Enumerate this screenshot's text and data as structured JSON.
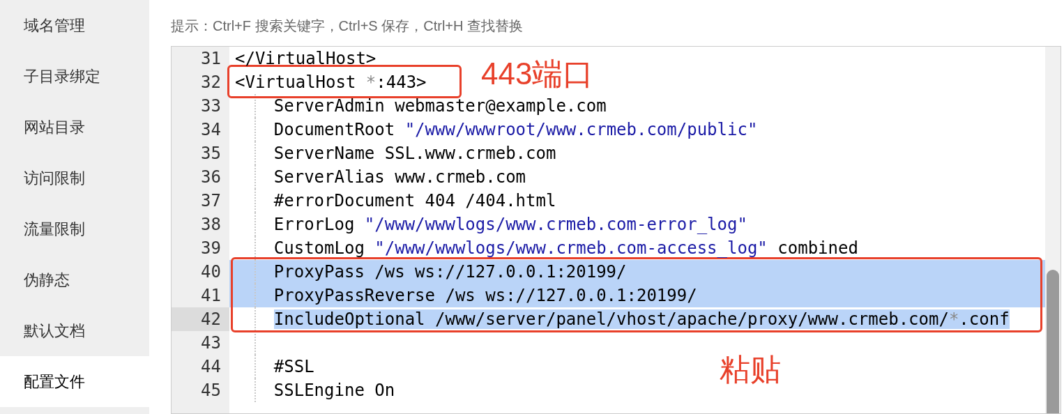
{
  "sidebar": {
    "items": [
      {
        "label": "域名管理",
        "selected": false
      },
      {
        "label": "子目录绑定",
        "selected": false
      },
      {
        "label": "网站目录",
        "selected": false
      },
      {
        "label": "访问限制",
        "selected": false
      },
      {
        "label": "流量限制",
        "selected": false
      },
      {
        "label": "伪静态",
        "selected": false
      },
      {
        "label": "默认文档",
        "selected": false
      },
      {
        "label": "配置文件",
        "selected": true
      }
    ]
  },
  "hint": "提示：Ctrl+F 搜索关键字，Ctrl+S 保存，Ctrl+H 查找替换",
  "editor": {
    "lines": [
      {
        "number": "31",
        "indent": false,
        "selected": false,
        "active": false,
        "segments": [
          {
            "kind": "text",
            "text": "</VirtualHost>"
          }
        ]
      },
      {
        "number": "32",
        "indent": false,
        "selected": false,
        "active": false,
        "segments": [
          {
            "kind": "text",
            "text": "<VirtualHost "
          },
          {
            "kind": "operator",
            "text": "*"
          },
          {
            "kind": "text",
            "text": ":443>"
          }
        ]
      },
      {
        "number": "33",
        "indent": true,
        "selected": false,
        "active": false,
        "segments": [
          {
            "kind": "text",
            "text": "ServerAdmin webmaster@example.com"
          }
        ]
      },
      {
        "number": "34",
        "indent": true,
        "selected": false,
        "active": false,
        "segments": [
          {
            "kind": "text",
            "text": "DocumentRoot "
          },
          {
            "kind": "string",
            "text": "\"/www/wwwroot/www.crmeb.com/public\""
          }
        ]
      },
      {
        "number": "35",
        "indent": true,
        "selected": false,
        "active": false,
        "segments": [
          {
            "kind": "text",
            "text": "ServerName SSL.www.crmeb.com"
          }
        ]
      },
      {
        "number": "36",
        "indent": true,
        "selected": false,
        "active": false,
        "segments": [
          {
            "kind": "text",
            "text": "ServerAlias www.crmeb.com"
          }
        ]
      },
      {
        "number": "37",
        "indent": true,
        "selected": false,
        "active": false,
        "segments": [
          {
            "kind": "text",
            "text": "#errorDocument 404 /404.html"
          }
        ]
      },
      {
        "number": "38",
        "indent": true,
        "selected": false,
        "active": false,
        "segments": [
          {
            "kind": "text",
            "text": "ErrorLog "
          },
          {
            "kind": "string",
            "text": "\"/www/wwwlogs/www.crmeb.com-error_log\""
          }
        ]
      },
      {
        "number": "39",
        "indent": true,
        "selected": false,
        "active": false,
        "segments": [
          {
            "kind": "text",
            "text": "CustomLog "
          },
          {
            "kind": "string",
            "text": "\"/www/wwwlogs/www.crmeb.com-access_log\""
          },
          {
            "kind": "text",
            "text": " combined"
          }
        ]
      },
      {
        "number": "40",
        "indent": true,
        "selected": true,
        "active": false,
        "segments": [
          {
            "kind": "text",
            "text": "ProxyPass /ws ws://127.0.0.1:20199/"
          }
        ]
      },
      {
        "number": "41",
        "indent": true,
        "selected": true,
        "active": false,
        "segments": [
          {
            "kind": "text",
            "text": "ProxyPassReverse /ws ws://127.0.0.1:20199/"
          }
        ]
      },
      {
        "number": "42",
        "indent": true,
        "selected": true,
        "active": true,
        "segments": [
          {
            "kind": "text",
            "text": "IncludeOptional /www/server/panel/vhost/apache/proxy/www.crmeb.com/"
          },
          {
            "kind": "operator",
            "text": "*"
          },
          {
            "kind": "text",
            "text": ".conf"
          }
        ]
      },
      {
        "number": "43",
        "indent": true,
        "selected": false,
        "active": false
      },
      {
        "number": "44",
        "indent": true,
        "selected": false,
        "active": false,
        "segments": [
          {
            "kind": "text",
            "text": "#SSL"
          }
        ]
      },
      {
        "number": "45",
        "indent": true,
        "selected": false,
        "active": false,
        "segments": [
          {
            "kind": "text",
            "text": "SSLEngine On"
          }
        ]
      }
    ]
  },
  "annotations": [
    {
      "text": "443端口"
    },
    {
      "text": "粘贴"
    }
  ]
}
